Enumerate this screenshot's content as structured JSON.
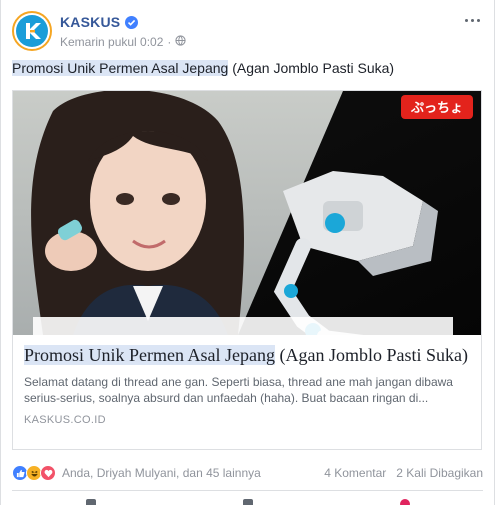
{
  "post": {
    "page_name": "KASKUS",
    "timestamp": "Kemarin pukul 0:02",
    "text_highlight": "Promosi Unik Permen Asal Jepang",
    "text_rest": " (Agan Jomblo Pasti Suka)"
  },
  "link": {
    "image_banner_text": "ぷっちょ",
    "title_highlight": "Promosi Unik Permen Asal Jepang",
    "title_rest": " (Agan Jomblo Pasti Suka)",
    "description": "Selamat datang di thread ane gan. Seperti biasa, thread ane mah jangan dibawa serius-serius, soalnya absurd dan unfaedah (haha). Buat bacaan ringan di...",
    "domain": "KASKUS.CO.ID"
  },
  "footer": {
    "reaction_names": "Anda, Driyah Mulyani, dan 45 lainnya",
    "comments": "4 Komentar",
    "shares": "2 Kali Dibagikan"
  },
  "colors": {
    "brand_link": "#365899",
    "verified": "#4080ff",
    "highlight": "#dbe5f5",
    "kaskus_blue": "#1a9dd9"
  },
  "icons": [
    "kaskus-logo-icon",
    "verified-icon",
    "globe-icon",
    "more-options-icon",
    "like-reaction-icon",
    "haha-reaction-icon",
    "love-reaction-icon"
  ]
}
